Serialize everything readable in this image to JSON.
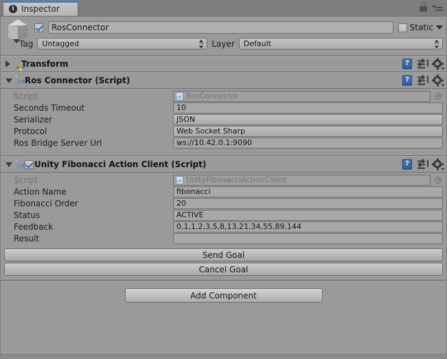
{
  "window": {
    "tab_label": "Inspector",
    "tab_icon": "info-icon",
    "lock_icon": "lock-icon",
    "menu_icon": "hamburger-menu-icon"
  },
  "game_object": {
    "icon": "cube-icon",
    "active_checked": true,
    "name": "RosConnector",
    "static_label": "Static",
    "static_checked": false,
    "tag_label": "Tag",
    "tag_value": "Untagged",
    "layer_label": "Layer",
    "layer_value": "Default"
  },
  "components": [
    {
      "title": "Transform",
      "icon": "transform-axis-icon",
      "expanded": false,
      "has_enable_checkbox": false,
      "tools": [
        "help-icon",
        "preset-icon",
        "gear-icon"
      ],
      "properties": []
    },
    {
      "title": "Ros Connector (Script)",
      "icon": "csharp-script-icon",
      "expanded": true,
      "has_enable_checkbox": false,
      "tools": [
        "help-icon",
        "preset-icon",
        "gear-icon"
      ],
      "properties": [
        {
          "label": "Script",
          "value": "RosConnector",
          "type": "object",
          "dimmed": true
        },
        {
          "label": "Seconds Timeout",
          "value": "10",
          "type": "text"
        },
        {
          "label": "Serializer",
          "value": "JSON",
          "type": "popup"
        },
        {
          "label": "Protocol",
          "value": "Web Socket Sharp",
          "type": "popup"
        },
        {
          "label": "Ros Bridge Server Url",
          "value": "ws://10.42.0.1:9090",
          "type": "text"
        }
      ]
    },
    {
      "title": "Unity Fibonacci Action Client (Script)",
      "icon": "csharp-script-icon",
      "expanded": true,
      "has_enable_checkbox": true,
      "enabled": true,
      "tools": [
        "help-icon",
        "preset-icon",
        "gear-icon"
      ],
      "properties": [
        {
          "label": "Script",
          "value": "UnityFibonacciActionClient",
          "type": "object",
          "dimmed": true
        },
        {
          "label": "Action Name",
          "value": "fibonacci",
          "type": "text"
        },
        {
          "label": "Fibonacci Order",
          "value": "20",
          "type": "text"
        },
        {
          "label": "Status",
          "value": "ACTIVE",
          "type": "text"
        },
        {
          "label": "Feedback",
          "value": "0,1,1,2,3,5,8,13,21,34,55,89,144",
          "type": "text"
        },
        {
          "label": "Result",
          "value": "",
          "type": "text"
        }
      ],
      "buttons": [
        {
          "label": "Send Goal"
        },
        {
          "label": "Cancel Goal"
        }
      ]
    }
  ],
  "footer": {
    "add_component_label": "Add Component"
  },
  "colors": {
    "panel_bg": "#9a9a9a",
    "field_bg": "#a8a8a8",
    "tab_accent": "#4a7fc1",
    "checkbox_check": "#2f6ab5",
    "border": "#6f6f6f"
  }
}
